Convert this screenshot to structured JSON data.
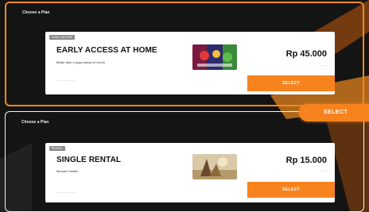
{
  "panels": [
    {
      "header": "Choose a Plan"
    },
    {
      "header": "Choose a Plan"
    }
  ],
  "plans": [
    {
      "tag": "EARLY ACCESS",
      "name": "EARLY ACCESS AT HOME",
      "description": "Better than 4 days ahead of Unreli",
      "sub": "————————",
      "price": "Rp 45.000",
      "price_note": "———",
      "button": "SELECT"
    },
    {
      "tag": "RENTAL",
      "name": "SINGLE RENTAL",
      "description": "Morwen Hadler",
      "sub": "————————",
      "price": "Rp 15.000",
      "price_note": "———",
      "button": "SELECT"
    }
  ],
  "side_button": "SELECT",
  "colors": {
    "accent": "#f7831f",
    "background": "#141414",
    "card": "#ffffff"
  }
}
